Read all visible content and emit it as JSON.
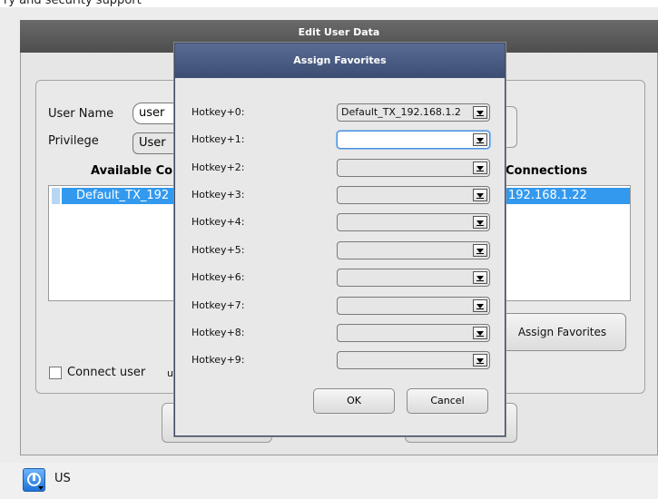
{
  "page": {
    "top_text": "ry and security support"
  },
  "edit_user": {
    "title": "Edit User Data",
    "user_name_label": "User Name",
    "user_name_value": "user",
    "privilege_label": "Privilege",
    "privilege_value": "User",
    "available_header": "Available Co",
    "connections_header": "Connections",
    "available_selected": "Default_TX_192",
    "connections_selected": "192.168.1.22",
    "assign_favorites_button": "Assign Favorites",
    "connect_user_label": "Connect user",
    "connect_user_suffix": "u",
    "connect_user_checked": false
  },
  "dialog": {
    "title": "Assign Favorites",
    "hotkeys": [
      {
        "label": "Hotkey+0:",
        "value": "Default_TX_192.168.1.2"
      },
      {
        "label": "Hotkey+1:",
        "value": ""
      },
      {
        "label": "Hotkey+2:",
        "value": ""
      },
      {
        "label": "Hotkey+3:",
        "value": ""
      },
      {
        "label": "Hotkey+4:",
        "value": ""
      },
      {
        "label": "Hotkey+5:",
        "value": ""
      },
      {
        "label": "Hotkey+6:",
        "value": ""
      },
      {
        "label": "Hotkey+7:",
        "value": ""
      },
      {
        "label": "Hotkey+8:",
        "value": ""
      },
      {
        "label": "Hotkey+9:",
        "value": ""
      }
    ],
    "ok_label": "OK",
    "cancel_label": "Cancel"
  },
  "statusbar": {
    "language": "US",
    "icon": "power-icon"
  }
}
